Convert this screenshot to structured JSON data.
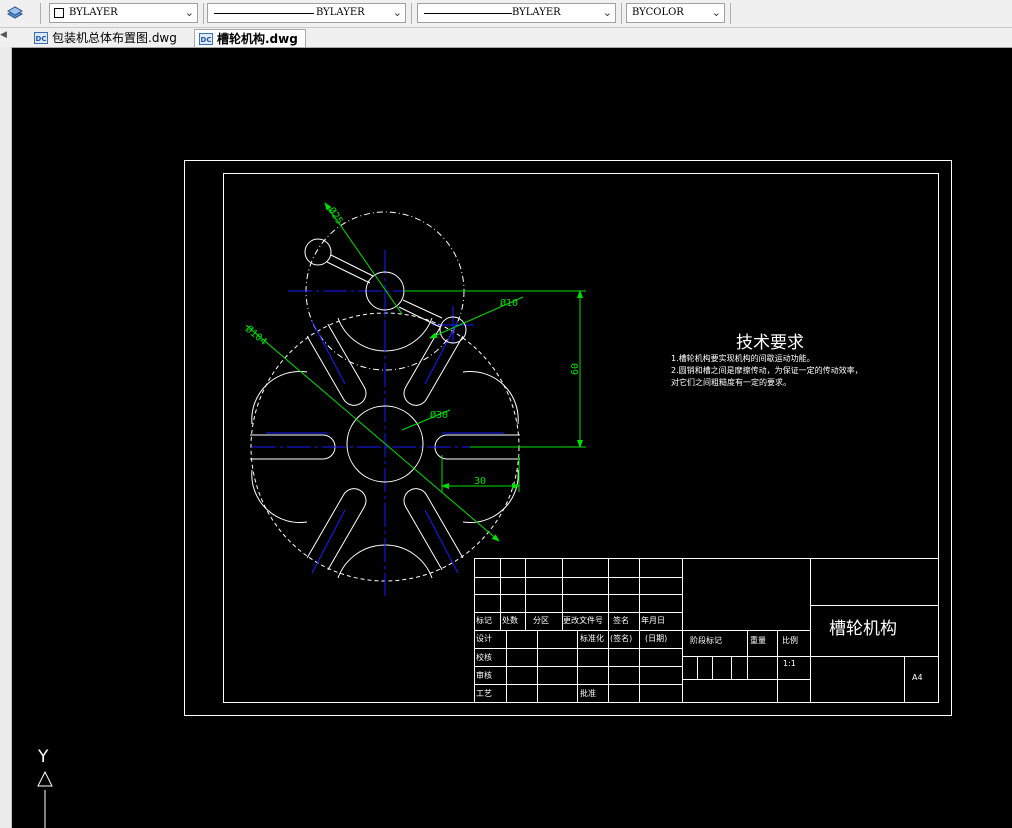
{
  "toolbar": {
    "layer_color": "BYLAYER",
    "linetype": "BYLAYER",
    "lineweight": "BYLAYER",
    "plot_style": "BYCOLOR"
  },
  "tabs": [
    {
      "label": "包装机总体布置图.dwg",
      "active": false
    },
    {
      "label": "槽轮机构.dwg",
      "active": true
    }
  ],
  "drawing": {
    "dims": {
      "d25": "Ø25",
      "d10": "Ø10",
      "d104": "Ø104",
      "d30": "Ø30",
      "v60": "60",
      "h30": "30"
    },
    "tech_title": "技术要求",
    "tech_lines": [
      "1.槽轮机构要实现机构的间歇运动功能。",
      "2.圆销和槽之间是摩擦传动，为保证一定的传动效率，",
      "对它们之间粗糙度有一定的要求。"
    ],
    "title_block": {
      "drawing_name": "槽轮机构",
      "paper_size": "A4",
      "scale": "1:1",
      "labels": {
        "mark": "标记",
        "count": "处数",
        "zone": "分区",
        "change_doc": "更改文件号",
        "sign": "签名",
        "date_head": "年月日",
        "design": "设计",
        "std": "标准化",
        "sign2": "(签名)",
        "date2": "(日期)",
        "stage": "阶段标记",
        "weight": "重量",
        "ratio": "比例",
        "check": "校核",
        "review": "审核",
        "process": "工艺",
        "approve": "批准"
      }
    },
    "ucs_y": "Y"
  },
  "colors": {
    "outline": "#ffffff",
    "center": "#1a1aff",
    "dimension": "#00e000"
  }
}
